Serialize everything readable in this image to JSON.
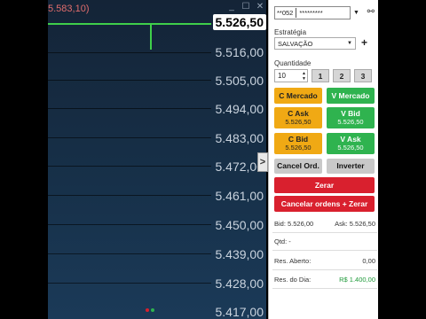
{
  "chart": {
    "title": "5.583,10)",
    "current_price": "5.526,50",
    "price_levels": [
      "5.516,00",
      "5.505,00",
      "5.494,00",
      "5.483,00",
      "5.472,00",
      "5.461,00",
      "5.450,00",
      "5.439,00",
      "5.428,00",
      "5.417,00"
    ],
    "colors": {
      "candle": "#3fcf4a",
      "title": "#e06c6c"
    }
  },
  "window": {
    "minimize": "_",
    "maximize": "☐",
    "close": "✕"
  },
  "collapse_tab": ">",
  "panel": {
    "account": {
      "prefix": "**052",
      "masked": "*********"
    },
    "strategy_label": "Estratégia",
    "strategy_value": "SALVAÇÃO",
    "quantity_label": "Quantidade",
    "quantity_value": "10",
    "quick_qty": [
      "1",
      "2",
      "3"
    ],
    "buy_market": "C Mercado",
    "sell_market": "V Mercado",
    "buy_ask": {
      "label": "C Ask",
      "price": "5.526,50"
    },
    "sell_bid": {
      "label": "V Bid",
      "price": "5.526,50"
    },
    "buy_bid": {
      "label": "C Bid",
      "price": "5.526,50"
    },
    "sell_ask": {
      "label": "V Ask",
      "price": "5.526,50"
    },
    "cancel_orders": "Cancel Ord.",
    "invert": "Inverter",
    "zero": "Zerar",
    "cancel_and_zero": "Cancelar ordens + Zerar",
    "bid": "Bid: 5.526,00",
    "ask": "Ask: 5.526,50",
    "qtd_label": "Qtd:",
    "qtd_value": "-",
    "open_result_label": "Res. Aberto:",
    "open_result_value": "0,00",
    "day_result_label": "Res. do Dia:",
    "day_result_value": "R$ 1.400,00"
  }
}
